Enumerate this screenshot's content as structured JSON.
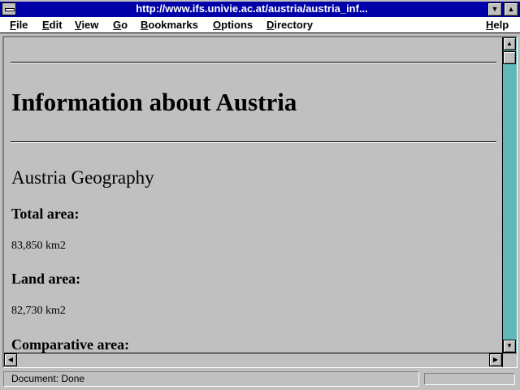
{
  "window": {
    "title": "http://www.ifs.univie.ac.at/austria/austria_inf..."
  },
  "menu": {
    "items": [
      "File",
      "Edit",
      "View",
      "Go",
      "Bookmarks",
      "Options",
      "Directory"
    ],
    "help": "Help"
  },
  "page": {
    "heading": "Information about Austria",
    "section_title": "Austria Geography",
    "fields": [
      {
        "label": "Total area:",
        "value": "83,850 km2"
      },
      {
        "label": "Land area:",
        "value": "82,730 km2"
      },
      {
        "label": "Comparative area:",
        "value": ""
      }
    ]
  },
  "status": {
    "text": "Document: Done"
  },
  "colors": {
    "titlebar": "#0000a8",
    "background": "#c0c0c0",
    "scroll_track": "#40a0a0"
  },
  "icons": [
    "system-menu-icon",
    "minimize-icon",
    "maximize-icon",
    "scroll-up-arrow-icon",
    "scroll-down-arrow-icon",
    "scroll-left-arrow-icon",
    "scroll-right-arrow-icon"
  ]
}
